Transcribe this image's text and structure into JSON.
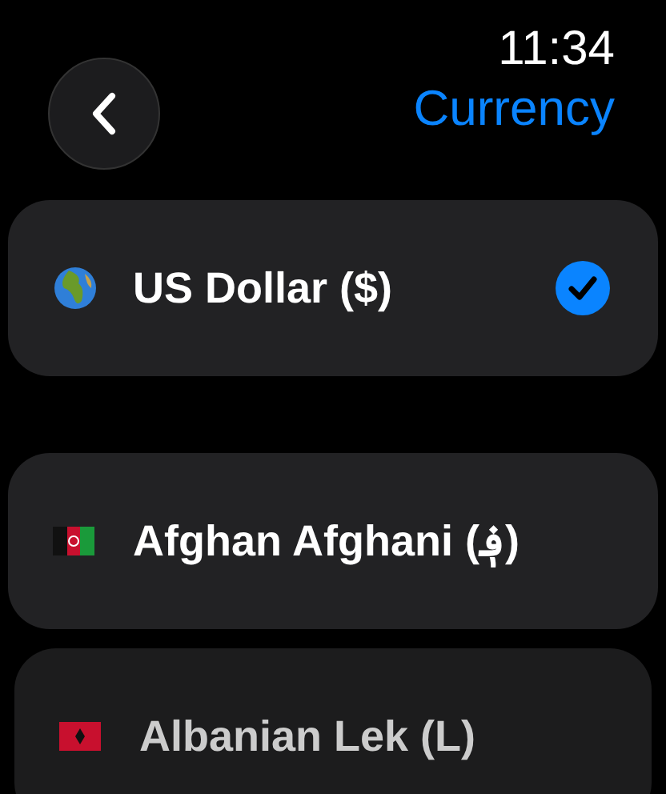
{
  "header": {
    "time": "11:34",
    "title": "Currency"
  },
  "currencies": [
    {
      "name": "US Dollar ($)",
      "kind": "globe",
      "selected": true,
      "dimmed": false
    },
    {
      "name": "Afghan Afghani (؋)",
      "kind": "flag-tricolor",
      "selected": false,
      "dimmed": false
    },
    {
      "name": "Albanian Lek (L)",
      "kind": "flag-red",
      "selected": false,
      "dimmed": true
    }
  ]
}
